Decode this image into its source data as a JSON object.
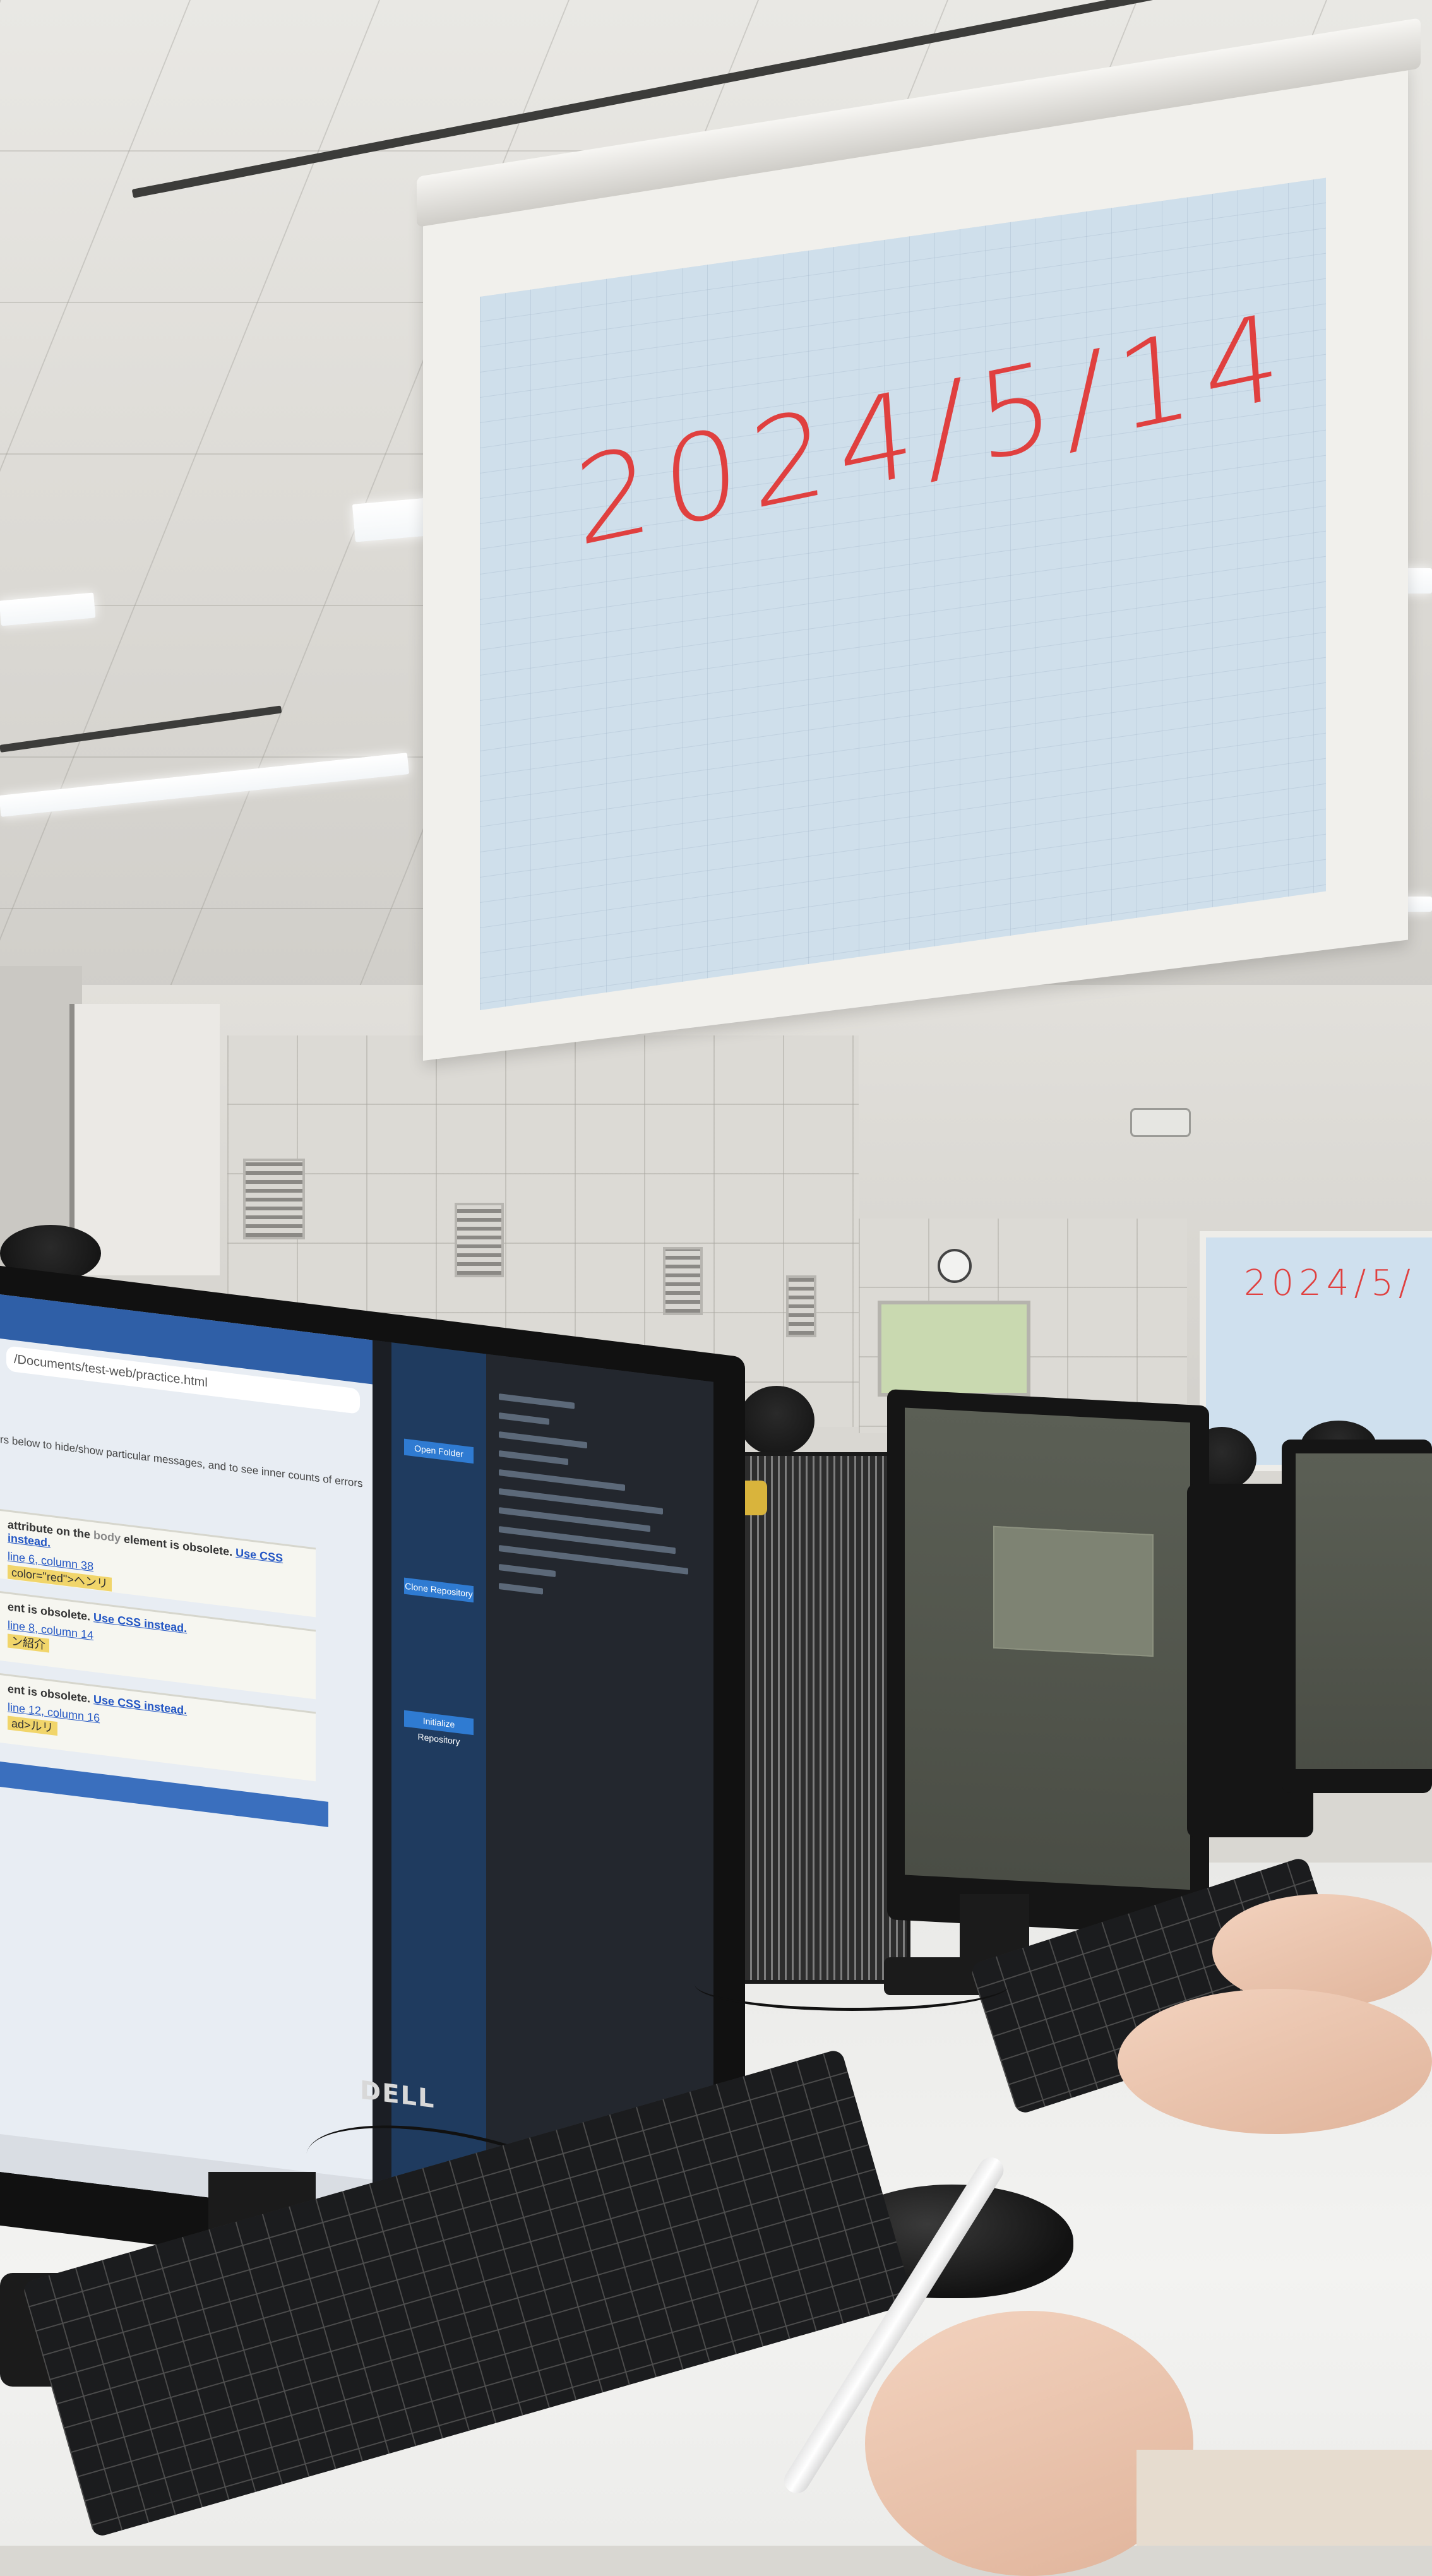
{
  "main_screen": {
    "handwritten_date": "2024/5/14"
  },
  "back_screen": {
    "handwritten_date": "2024/5/"
  },
  "foreground_monitor": {
    "brand": "DELL",
    "browser": {
      "address": "/Documents/test-web/practice.html",
      "intro_text": "rs below to hide/show particular messages, and to see inner counts of errors and",
      "warnings": [
        {
          "prefix": "attribute on the",
          "tag": "body",
          "suffix": "element is obsolete.",
          "link": "Use CSS instead.",
          "location": "line 6, column 38",
          "chip": "color=\"red\">ヘンリ"
        },
        {
          "prefix": "ent is obsolete.",
          "tag": "",
          "suffix": "",
          "link": "Use CSS instead.",
          "location": "line 8, column 14",
          "chip": "ン紹介"
        },
        {
          "prefix": "ent is obsolete.",
          "tag": "",
          "suffix": "",
          "link": "Use CSS instead.",
          "location": "line 12, column 16",
          "chip": "ad>ルリ"
        }
      ]
    },
    "editor": {
      "button_1": "Open Folder",
      "button_2": "Clone Repository",
      "button_3": "Initialize Repository"
    }
  },
  "colors": {
    "projection_surface": "#cfdfeb",
    "handwriting": "#e0403f",
    "monitor_bezel": "#151515",
    "desk": "#f0f0ee"
  }
}
